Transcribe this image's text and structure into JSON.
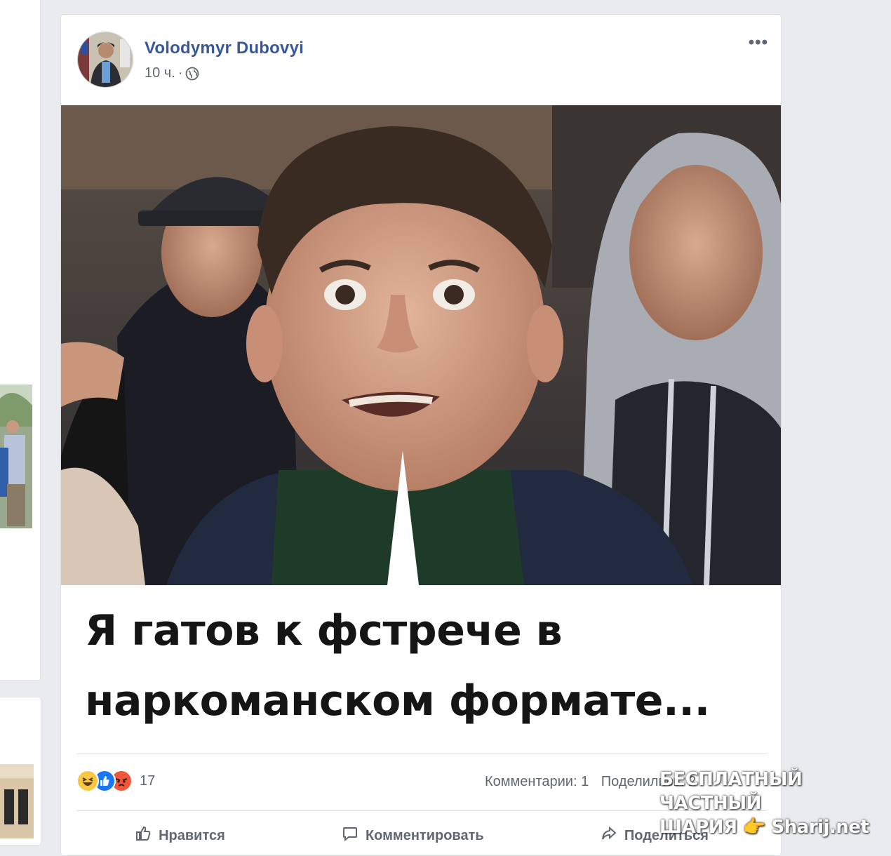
{
  "post": {
    "author": "Volodymyr Dubovyi",
    "time": "10 ч.",
    "separator": "·",
    "more_label": "•••",
    "caption": {
      "line1": "Я гатов к фстрече в",
      "line2": "наркоманском формате..."
    },
    "reactions": {
      "types": [
        "haha",
        "like",
        "angry"
      ],
      "count": "17"
    },
    "stats": {
      "comments": "Комментарии: 1",
      "shares": "Поделились: 2"
    },
    "actions": {
      "like": "Нравится",
      "comment": "Комментировать",
      "share": "Поделиться"
    }
  },
  "watermark": {
    "line1": "БЕСПЛАТНЫЙ ЧАСТНЫЙ",
    "line2": "ШАРИЯ 👉 Sharij.net"
  },
  "colors": {
    "author": "#385898",
    "background": "#e9ebee",
    "like_blue": "#1877f2",
    "angry_orange": "#f0573a",
    "haha_yellow": "#f7c844"
  }
}
